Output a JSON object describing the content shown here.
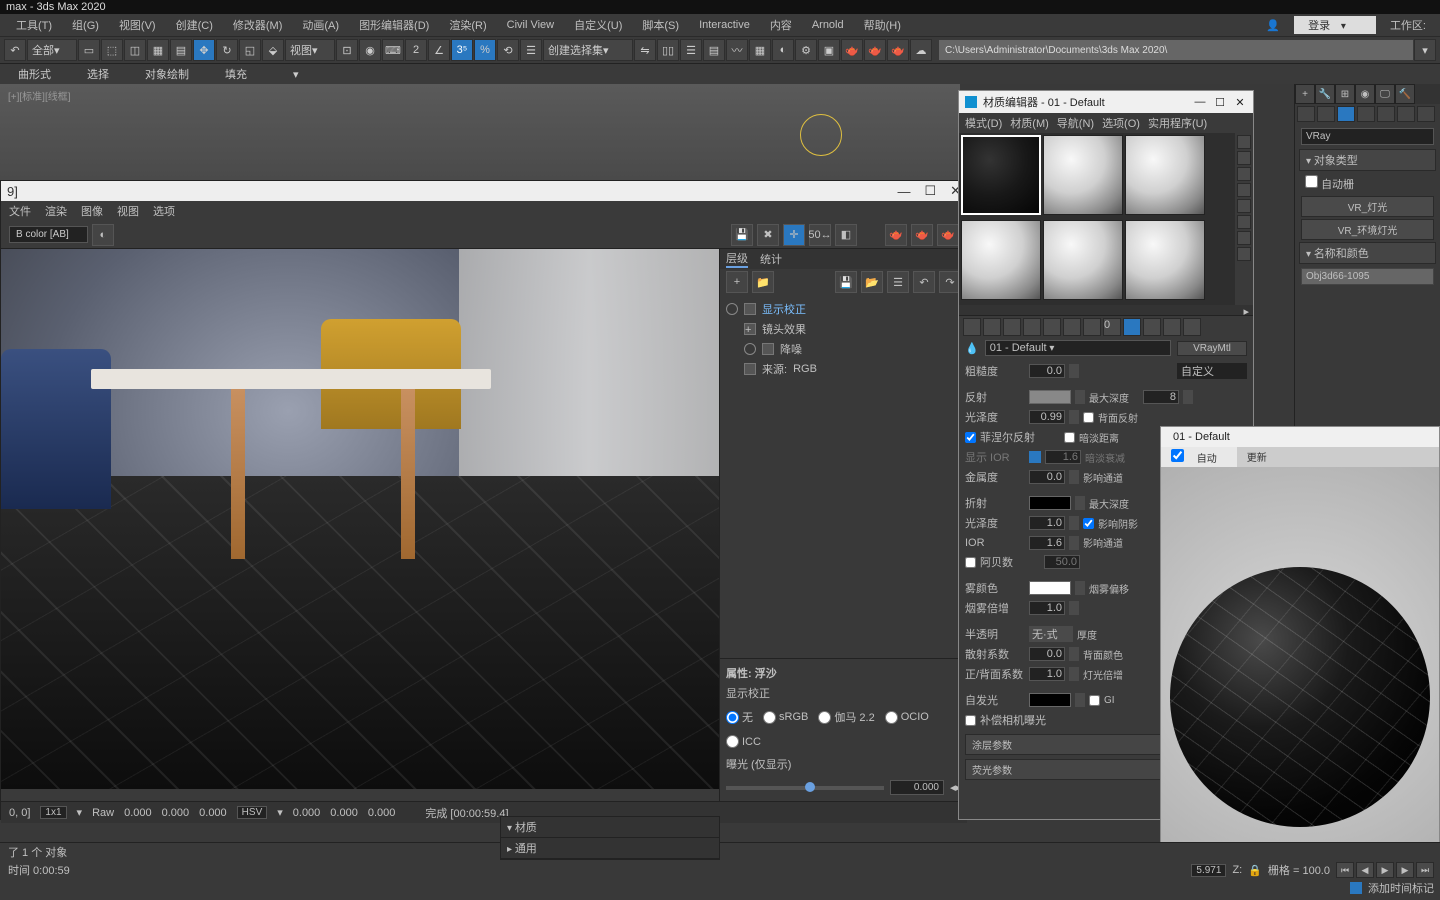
{
  "app": {
    "title": "max - 3ds Max 2020"
  },
  "menu": {
    "items": [
      "工具(T)",
      "组(G)",
      "视图(V)",
      "创建(C)",
      "修改器(M)",
      "动画(A)",
      "图形编辑器(D)",
      "渲染(R)",
      "Civil View",
      "自定义(U)",
      "脚本(S)",
      "Interactive",
      "内容",
      "Arnold",
      "帮助(H)"
    ],
    "login": "登录",
    "workspace": "工作区:"
  },
  "toolbar": {
    "all": "全部",
    "view": "视图",
    "create_sel": "创建选择集",
    "path": "C:\\Users\\Administrator\\Documents\\3ds Max 2020\\"
  },
  "ribbon": {
    "items": [
      "曲形式",
      "选择",
      "对象绘制",
      "填充"
    ]
  },
  "viewport": {
    "label": "[+][标准][线框]"
  },
  "render": {
    "top_suffix": "9]",
    "menu": [
      "文件",
      "渲染",
      "图像",
      "视图",
      "选项"
    ],
    "colorspace": "B color [AB]",
    "tabs": {
      "layer": "层级",
      "stats": "统计"
    },
    "tree": {
      "show_correction": "显示校正",
      "lens": "镜头效果",
      "noise": "降噪",
      "source": "来源:",
      "source_val": "RGB"
    },
    "props": {
      "header": "属性: 浮沙",
      "section": "显示校正",
      "radios": [
        "无",
        "sRGB",
        "伽马 2.2",
        "OCIO",
        "ICC"
      ],
      "exposure": "曝光 (仅显示)",
      "exp_val": "0.000"
    },
    "status": {
      "coord": "0, 0]",
      "scale": "1x1",
      "raw": "Raw",
      "v1": "0.000",
      "v2": "0.000",
      "v3": "0.000",
      "mode": "HSV",
      "h": "0.000",
      "s": "0.000",
      "v": "0.000",
      "done": "完成 [00:00:59.4]"
    }
  },
  "mat": {
    "title": "材质编辑器 - 01 - Default",
    "menu": [
      "模式(D)",
      "材质(M)",
      "导航(N)",
      "选项(O)",
      "实用程序(U)"
    ],
    "name": "01 - Default",
    "type": "VRayMtl",
    "params": {
      "roughness": "粗糙度",
      "rough_v": "0.0",
      "custom": "自定义",
      "reflect": "反射",
      "maxdepth": "最大深度",
      "maxdepth_v": "8",
      "gloss": "光泽度",
      "gloss_v": "0.99",
      "backref": "背面反射",
      "fresnel": "菲涅尔反射",
      "dimdist": "暗淡距离",
      "showior": "显示 IOR",
      "ior_disp": "1.6",
      "dimfall": "暗淡衰减",
      "metal": "金属度",
      "metal_v": "0.0",
      "affch": "影响通道",
      "refract": "折射",
      "rmaxdepth": "最大深度",
      "rgloss": "光泽度",
      "rgloss_v": "1.0",
      "affshadow": "影响阴影",
      "ior": "IOR",
      "ior_v": "1.6",
      "raffch": "影响通道",
      "abbe": "阿贝数",
      "abbe_v": "50.0",
      "fogcolor": "雾颜色",
      "fogbias": "烟雾偏移",
      "fogmult": "烟雾倍增",
      "fogmult_v": "1.0",
      "translucent": "半透明",
      "tmode": "无·式",
      "thickness": "厚度",
      "scatter": "散射系数",
      "scatter_v": "0.0",
      "backcolor": "背面颜色",
      "fwdback": "正/背面系数",
      "fwdback_v": "1.0",
      "lightmult": "灯光倍增",
      "selfillum": "自发光",
      "gi": "GI",
      "compcam": "补偿相机曝光",
      "roll1": "涂层参数",
      "roll2": "荧光参数"
    }
  },
  "cmd": {
    "renderer": "VRay",
    "roll_objtype": "对象类型",
    "autogrid": "自动栅",
    "btn1": "VR_灯光",
    "btn2": "VR_环境灯光",
    "roll_namecolor": "名称和颜色",
    "objname": "Obj3d66-1095"
  },
  "preview": {
    "title": "01 - Default",
    "tab_auto": "自动",
    "tab_update": "更新"
  },
  "bottom": {
    "sel": "了 1 个 对象",
    "time": "时间  0:00:59",
    "frame": "5.971",
    "z": "Z:",
    "grid": "栅格 = 100.0",
    "addtime": "添加时间标记",
    "matlabel": "材质",
    "general": "通用"
  }
}
